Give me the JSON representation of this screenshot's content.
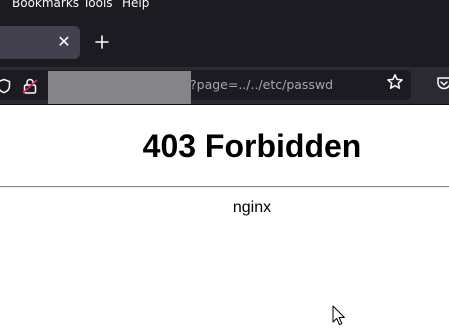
{
  "menubar": {
    "bookmarks_label": "Bookmarks",
    "tools_label": "Tools",
    "help_label": "Help"
  },
  "tab": {
    "close_icon": "close-icon",
    "new_tab_icon": "plus-icon"
  },
  "navbar": {
    "url_visible": "?page=../../etc/passwd",
    "icons": [
      "shield-icon",
      "lock-icon",
      "star-icon",
      "pocket-icon"
    ]
  },
  "page": {
    "heading": "403 Forbidden",
    "server": "nginx"
  },
  "colors": {
    "chrome_dark": "#1c1b22",
    "tab_active": "#42414d",
    "toolbar": "#2b2a33",
    "url_text": "#a7a6ad",
    "redaction": "#858488",
    "page_bg": "#ffffff"
  }
}
